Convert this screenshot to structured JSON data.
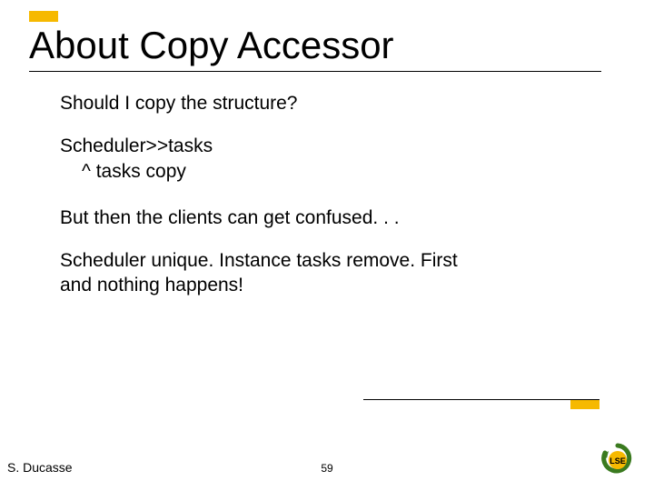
{
  "title": "About Copy Accessor",
  "body": {
    "q": "Should I copy the structure?",
    "code1": "Scheduler>>tasks",
    "code2": "^ tasks copy",
    "note": "But then the clients can get confused. . .",
    "ex1": "Scheduler unique. Instance tasks remove. First",
    "ex2": "and nothing happens!"
  },
  "footer": {
    "author": "S. Ducasse",
    "page": "59"
  },
  "logo_label": "LSE"
}
